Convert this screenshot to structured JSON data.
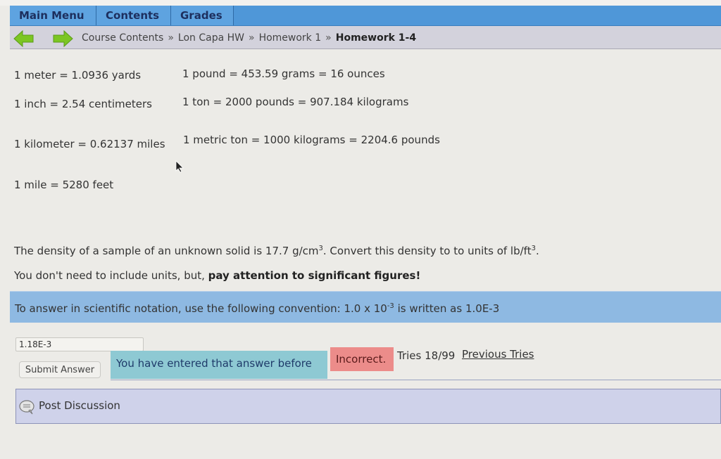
{
  "menu": {
    "tabs": [
      {
        "label": "Main Menu"
      },
      {
        "label": "Contents"
      },
      {
        "label": "Grades"
      }
    ]
  },
  "nav": {
    "back_icon": "green-left-arrow",
    "forward_icon": "green-right-arrow",
    "breadcrumb": [
      "Course Contents",
      "Lon Capa HW",
      "Homework 1"
    ],
    "separator": "»",
    "current": "Homework 1-4"
  },
  "conversions": {
    "left": [
      "1 meter = 1.0936 yards",
      "1 inch = 2.54 centimeters",
      "1 kilometer = 0.62137 miles",
      "1 mile = 5280 feet"
    ],
    "right": [
      "1 pound = 453.59 grams = 16 ounces",
      "1 ton = 2000 pounds = 907.184 kilograms",
      "1 metric ton = 1000 kilograms = 2204.6 pounds"
    ]
  },
  "question": {
    "part1": "The density of a sample of an unknown solid is 17.7 g/cm",
    "exp1": "3",
    "part2": ". Convert this density to to units of lb/ft",
    "exp2": "3",
    "part3": "."
  },
  "instruction": {
    "normal": "You don't need to include units, but, ",
    "bold": "pay attention to significant figures!"
  },
  "scientific": {
    "pre": "To answer in scientific notation, use the following convention: 1.0 x 10",
    "exp": "-3",
    "post": " is written as 1.0E-3"
  },
  "answer": {
    "value": "1.18E-3",
    "submit_label": "Submit Answer",
    "previous_message": "You have entered that answer before",
    "status": "Incorrect.",
    "tries": "Tries 18/99",
    "previous_tries_link": "Previous Tries"
  },
  "discussion": {
    "label": "Post Discussion",
    "icon": "speech-bubble"
  },
  "colors": {
    "menu_bar": "#4f97d8",
    "nav_bar": "#d3d2dc",
    "sci_box": "#8eb9e2",
    "prev_msg": "#8ec9d3",
    "incorrect": "#ec8c8a",
    "discussion": "#cfd2ea",
    "arrow_green": "#7cc623"
  }
}
